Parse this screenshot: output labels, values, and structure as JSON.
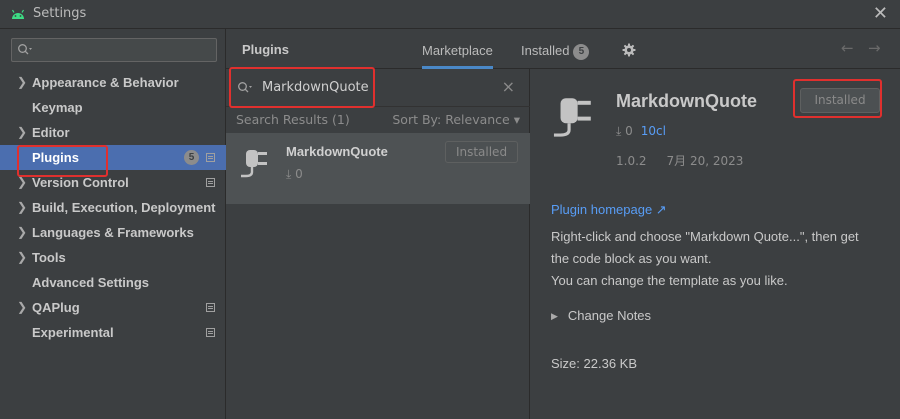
{
  "window": {
    "title": "Settings",
    "close_glyph": "✕"
  },
  "sidebar": {
    "search_placeholder": "",
    "items": [
      {
        "label": "Appearance & Behavior",
        "expandable": true
      },
      {
        "label": "Keymap",
        "expandable": false
      },
      {
        "label": "Editor",
        "expandable": true
      },
      {
        "label": "Plugins",
        "expandable": false,
        "selected": true,
        "badge": "5"
      },
      {
        "label": "Version Control",
        "expandable": true
      },
      {
        "label": "Build, Execution, Deployment",
        "expandable": true
      },
      {
        "label": "Languages & Frameworks",
        "expandable": true
      },
      {
        "label": "Tools",
        "expandable": true
      },
      {
        "label": "Advanced Settings",
        "expandable": false
      },
      {
        "label": "QAPlug",
        "expandable": true
      },
      {
        "label": "Experimental",
        "expandable": false
      }
    ]
  },
  "plugins_page": {
    "heading": "Plugins",
    "tabs": [
      {
        "label": "Marketplace",
        "active": true
      },
      {
        "label": "Installed",
        "badge": "5"
      }
    ],
    "back_glyph": "←",
    "forward_glyph": "→"
  },
  "search": {
    "query": "MarkdownQuote",
    "clear_glyph": "×",
    "results_count": "Search Results (1)",
    "sort_label": "Sort By: Relevance ▾"
  },
  "result": {
    "name": "MarkdownQuote",
    "downloads": "⤓ 0",
    "button_label": "Installed"
  },
  "detail": {
    "name": "MarkdownQuote",
    "downloads": "⤓ 0",
    "vendor": "10cl",
    "version": "1.0.2",
    "date": "7月 20, 2023",
    "button_label": "Installed",
    "homepage": "Plugin homepage ↗",
    "description_line1": "Right-click and choose \"Markdown Quote...\", then get",
    "description_line2": "the code block as you want.",
    "description_line3": "You can change the template as you like.",
    "change_notes": "Change Notes",
    "change_notes_glyph": "▶",
    "size": "Size: 22.36 KB"
  },
  "colors": {
    "background": "#3c3f41",
    "selection": "#4b6eaf",
    "link": "#589df6",
    "highlight": "#e0302e"
  },
  "icons": {
    "app": "android-icon",
    "search": "search-icon",
    "settings": "gear-icon",
    "plugin": "plug-icon",
    "projects": "project-level-icon"
  }
}
